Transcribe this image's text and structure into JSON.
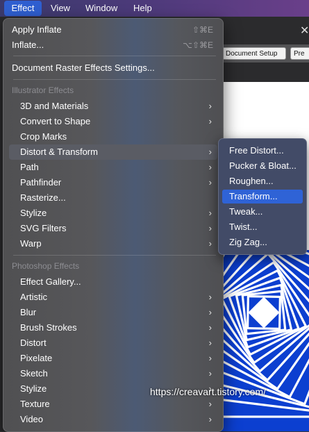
{
  "menubar": {
    "items": [
      "Effect",
      "View",
      "Window",
      "Help"
    ]
  },
  "toolbar": {
    "document_setup": "Document Setup",
    "prefs_partial": "Pre"
  },
  "menu": {
    "apply_inflate": {
      "label": "Apply Inflate",
      "shortcut": "⇧⌘E"
    },
    "inflate": {
      "label": "Inflate...",
      "shortcut": "⌥⇧⌘E"
    },
    "raster_settings": "Document Raster Effects Settings...",
    "illustrator_header": "Illustrator Effects",
    "illustrator_items": [
      {
        "label": "3D and Materials",
        "submenu": true
      },
      {
        "label": "Convert to Shape",
        "submenu": true
      },
      {
        "label": "Crop Marks",
        "submenu": false
      },
      {
        "label": "Distort & Transform",
        "submenu": true,
        "highlighted": true
      },
      {
        "label": "Path",
        "submenu": true
      },
      {
        "label": "Pathfinder",
        "submenu": true
      },
      {
        "label": "Rasterize...",
        "submenu": false
      },
      {
        "label": "Stylize",
        "submenu": true
      },
      {
        "label": "SVG Filters",
        "submenu": true
      },
      {
        "label": "Warp",
        "submenu": true
      }
    ],
    "photoshop_header": "Photoshop Effects",
    "photoshop_items": [
      {
        "label": "Effect Gallery...",
        "submenu": false
      },
      {
        "label": "Artistic",
        "submenu": true
      },
      {
        "label": "Blur",
        "submenu": true
      },
      {
        "label": "Brush Strokes",
        "submenu": true
      },
      {
        "label": "Distort",
        "submenu": true
      },
      {
        "label": "Pixelate",
        "submenu": true
      },
      {
        "label": "Sketch",
        "submenu": true
      },
      {
        "label": "Stylize",
        "submenu": true
      },
      {
        "label": "Texture",
        "submenu": true
      },
      {
        "label": "Video",
        "submenu": true
      }
    ],
    "arrow_glyph": "›"
  },
  "submenu": {
    "items": [
      "Free Distort...",
      "Pucker & Bloat...",
      "Roughen...",
      "Transform...",
      "Tweak...",
      "Twist...",
      "Zig Zag..."
    ],
    "selected": "Transform..."
  },
  "watermark": "https://creavart.tistory.com/",
  "colors": {
    "menubar_active": "#2f5fd0",
    "submenu_selected": "#2f63d6",
    "artwork_blue": "#0c3fd0"
  }
}
